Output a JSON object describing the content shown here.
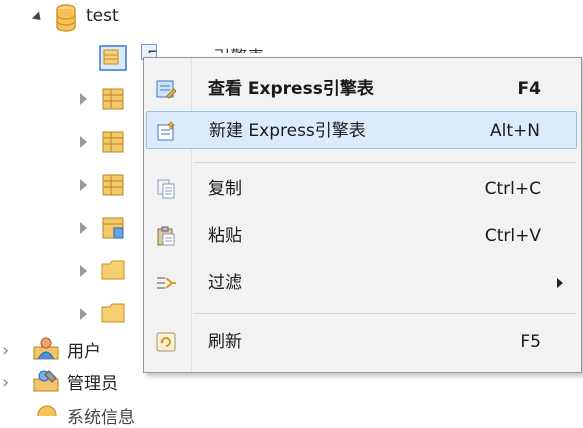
{
  "tree": {
    "root_label": "test",
    "selected_table_label_partial": "Express引擎表",
    "users_label": "用户",
    "admins_label": "管理员",
    "bottom_label_partial": "系统信息"
  },
  "context_menu": {
    "items": [
      {
        "label": "查看 Express引擎表",
        "shortcut": "F4",
        "bold": true,
        "icon": "view-table-icon"
      },
      {
        "label": "新建 Express引擎表",
        "shortcut": "Alt+N",
        "bold": false,
        "highlighted": true,
        "icon": "new-table-icon"
      },
      {
        "label": "复制",
        "shortcut": "Ctrl+C",
        "icon": "copy-icon"
      },
      {
        "label": "粘贴",
        "shortcut": "Ctrl+V",
        "icon": "paste-icon"
      },
      {
        "label": "过滤",
        "shortcut": "",
        "submenu": true,
        "icon": "filter-icon"
      },
      {
        "label": "刷新",
        "shortcut": "F5",
        "icon": "refresh-icon"
      }
    ]
  },
  "colors": {
    "highlight_bg": "#dcebfc",
    "highlight_border": "#93c2f1",
    "db_icon": "#f2b84b",
    "menu_bg": "#f2f2f2"
  }
}
